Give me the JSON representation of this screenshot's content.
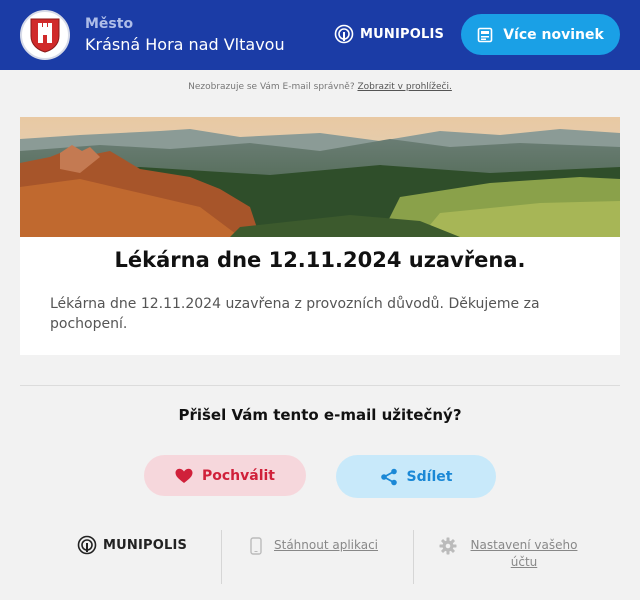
{
  "header": {
    "town_label": "Město",
    "town_name": "Krásná Hora nad Vltavou",
    "brand": "MUNIPOLIS",
    "more_news_label": "Více novinek",
    "crest_icon": "town-crest-icon"
  },
  "preheader": {
    "text": "Nezobrazuje se Vám E-mail správně?",
    "link": "Zobrazit v prohlížeči."
  },
  "article": {
    "image": "landscape-photo",
    "title": "Lékárna dne 12.11.2024 uzavřena.",
    "body": "Lékárna dne 12.11.2024 uzavřena z provozních důvodů. Děkujeme za pochopení."
  },
  "feedback": {
    "question": "Přišel Vám tento e-mail užitečný?",
    "praise_label": "Pochválit",
    "share_label": "Sdílet"
  },
  "footer": {
    "brand": "MUNIPOLIS",
    "app_link": "Stáhnout aplikaci",
    "settings_link": "Nastavení vašeho účtu"
  },
  "colors": {
    "header_bg": "#1b3ca6",
    "accent_blue": "#1aa0e6",
    "praise_red": "#d0203a",
    "page_bg": "#f2f2f2"
  }
}
